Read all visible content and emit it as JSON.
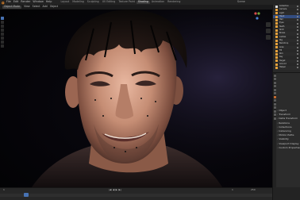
{
  "app": {
    "menu": [
      "File",
      "Edit",
      "Render",
      "Window",
      "Help"
    ],
    "workspace_tabs": [
      "Layout",
      "Modeling",
      "Sculpting",
      "UV Editing",
      "Texture Paint",
      "Shading",
      "Animation",
      "Rendering"
    ],
    "active_tab": "Shading",
    "scene_name": "Scene"
  },
  "viewport": {
    "mode_label": "Object Mode",
    "header_items": [
      "View",
      "Select",
      "Add",
      "Object"
    ],
    "shading_mode": "Rendered"
  },
  "outliner": {
    "rows": [
      {
        "name": "Collection"
      },
      {
        "name": "Camera"
      },
      {
        "name": "Light"
      },
      {
        "name": "Head"
      },
      {
        "name": "Hair"
      },
      {
        "name": "Eyes"
      },
      {
        "name": "Teeth"
      },
      {
        "name": "Shirt"
      },
      {
        "name": "Brows"
      },
      {
        "name": "Lashes"
      },
      {
        "name": "Rig"
      },
      {
        "name": "Backdrop"
      },
      {
        "name": "Area"
      },
      {
        "name": "Fill"
      },
      {
        "name": "Rim"
      },
      {
        "name": "Key"
      },
      {
        "name": "Target"
      },
      {
        "name": "Ground"
      },
      {
        "name": "Helper"
      }
    ]
  },
  "properties": {
    "sections": [
      "Object",
      "Transform",
      "Delta Transform",
      "Relations",
      "Collections",
      "Instancing",
      "Motion Paths",
      "Visibility",
      "Viewport Display",
      "Custom Properties"
    ]
  },
  "timeline": {
    "current_frame": "1",
    "start_frame": "1",
    "end_frame": "250"
  },
  "colors": {
    "accent": "#4772b3",
    "object_icon": "#e8a23b",
    "active_properties_tab": "#c46a2f"
  }
}
